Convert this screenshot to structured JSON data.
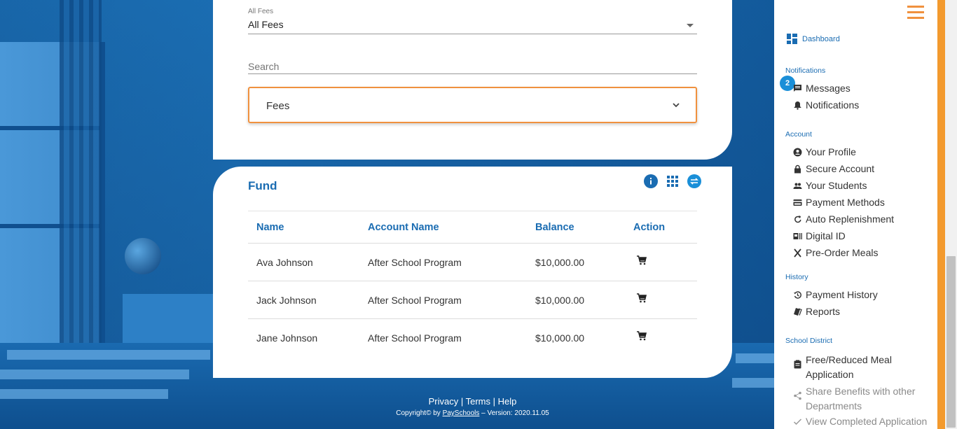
{
  "filter": {
    "label": "All Fees",
    "value": "All Fees"
  },
  "search": {
    "placeholder": "Search"
  },
  "fees_panel": {
    "label": "Fees"
  },
  "fund": {
    "title": "Fund",
    "columns": [
      "Name",
      "Account Name",
      "Balance",
      "Action"
    ],
    "rows": [
      {
        "name": "Ava Johnson",
        "account": "After School Program",
        "balance": "$10,000.00"
      },
      {
        "name": "Jack Johnson",
        "account": "After School Program",
        "balance": "$10,000.00"
      },
      {
        "name": "Jane Johnson",
        "account": "After School Program",
        "balance": "$10,000.00"
      }
    ]
  },
  "footer": {
    "privacy": "Privacy",
    "terms": "Terms",
    "help": "Help",
    "separator": "|",
    "copyright_prefix": "Copyright© by ",
    "brand": "PaySchools",
    "version": " – Version: 2020.11.05"
  },
  "sidebar": {
    "dashboard": "Dashboard",
    "notifications_section": "Notifications",
    "messages_badge": "2",
    "messages": "Messages",
    "notifications": "Notifications",
    "account_section": "Account",
    "account_items": [
      "Your Profile",
      "Secure Account",
      "Your Students",
      "Payment Methods",
      "Auto Replenishment",
      "Digital ID",
      "Pre-Order Meals"
    ],
    "history_section": "History",
    "history_items": [
      "Payment History",
      "Reports"
    ],
    "district_section": "School District",
    "district_items": [
      "Free/Reduced Meal Application",
      "Share Benefits with other Departments",
      "View Completed Application"
    ]
  },
  "colors": {
    "accent_blue": "#1a6cb2",
    "accent_orange": "#f0913e"
  },
  "icons": {
    "fund_actions": [
      "info-icon",
      "grid-icon",
      "transfer-icon"
    ],
    "row_action": "cart-icon"
  }
}
